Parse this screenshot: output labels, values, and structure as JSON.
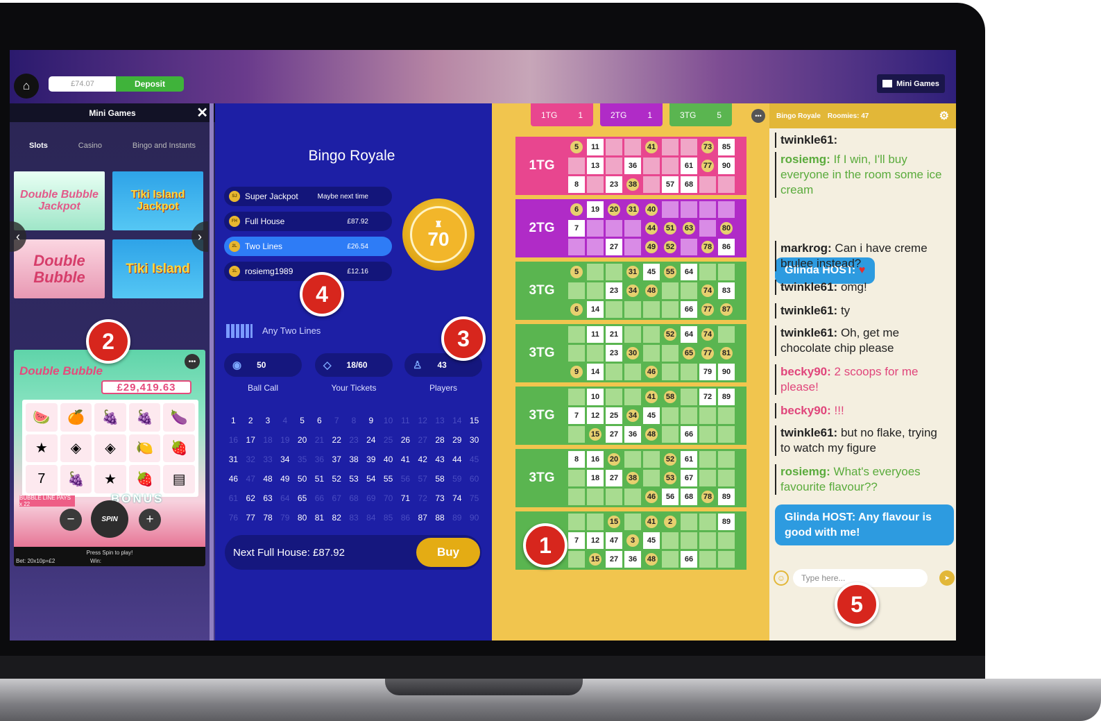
{
  "topbar": {
    "balance": "£74.07",
    "deposit_label": "Deposit",
    "mini_games_label": "Mini Games"
  },
  "mini_games": {
    "title": "Mini Games",
    "tabs": [
      "Slots",
      "Casino",
      "Bingo and Instants"
    ],
    "thumbs": [
      "Double Bubble Jackpot",
      "Tiki Island Jackpot",
      "Double Bubble",
      "Tiki Island"
    ],
    "slot": {
      "title": "Double Bubble",
      "jackpot": "£29,419.63",
      "bubble_line": "BUBBLE LINE PAYS x 22",
      "bonus": "BONUS",
      "spin_label": "SPIN",
      "press": "Press Spin to play!",
      "bet": "Bet: 20x10p=£2",
      "win": "Win:"
    }
  },
  "bingo": {
    "title": "Bingo Royale",
    "prizes": [
      {
        "badge": "SJ",
        "label": "Super Jackpot",
        "amount": "Maybe next time"
      },
      {
        "badge": "FH",
        "label": "Full House",
        "amount": "£87.92"
      },
      {
        "badge": "2L",
        "label": "Two Lines",
        "amount": "£26.54"
      },
      {
        "badge": "1L",
        "label": "rosiemg1989",
        "amount": "£12.16"
      }
    ],
    "ball": "70",
    "pattern": "Any Two Lines",
    "stats": [
      {
        "value": "50",
        "label": "Ball Call"
      },
      {
        "value": "18/60",
        "label": "Your Tickets"
      },
      {
        "value": "43",
        "label": "Players"
      }
    ],
    "called": [
      1,
      2,
      3,
      5,
      6,
      9,
      15,
      17,
      20,
      22,
      24,
      26,
      28,
      29,
      30,
      31,
      34,
      37,
      38,
      39,
      40,
      41,
      42,
      43,
      44,
      46,
      48,
      49,
      50,
      51,
      52,
      53,
      54,
      55,
      58,
      62,
      63,
      65,
      71,
      73,
      74,
      77,
      78,
      80,
      81,
      82,
      87,
      88
    ],
    "next_full_house_label": "Next Full House:",
    "next_full_house": "£87.92",
    "buy_label": "Buy"
  },
  "tickets": {
    "tabs": [
      {
        "label": "1TG",
        "count": "1"
      },
      {
        "label": "2TG",
        "count": "1"
      },
      {
        "label": "3TG",
        "count": "5"
      }
    ],
    "cards": [
      {
        "label": "1TG",
        "rows": [
          [
            "5",
            "11",
            "",
            "",
            "41",
            "",
            "",
            "73",
            "85"
          ],
          [
            "",
            "13",
            "",
            "36",
            "",
            "",
            "61",
            "77",
            "90"
          ],
          [
            "8",
            "",
            "23",
            "38",
            "",
            "57",
            "68",
            "",
            ""
          ]
        ]
      },
      {
        "label": "2TG",
        "rows": [
          [
            "6",
            "19",
            "20",
            "31",
            "40",
            "",
            "",
            "",
            ""
          ],
          [
            "7",
            "",
            "",
            "",
            "44",
            "51",
            "63",
            "",
            "80"
          ],
          [
            "",
            "",
            "27",
            "",
            "49",
            "52",
            "",
            "78",
            "86"
          ]
        ]
      },
      {
        "label": "3TG",
        "rows": [
          [
            "5",
            "",
            "",
            "31",
            "45",
            "55",
            "64",
            "",
            ""
          ],
          [
            "",
            "",
            "23",
            "34",
            "48",
            "",
            "",
            "74",
            "83"
          ],
          [
            "6",
            "14",
            "",
            "",
            "",
            "",
            "66",
            "77",
            "87"
          ]
        ]
      },
      {
        "label": "3TG",
        "rows": [
          [
            "",
            "11",
            "21",
            "",
            "",
            "52",
            "64",
            "74",
            ""
          ],
          [
            "",
            "",
            "23",
            "30",
            "",
            "",
            "65",
            "77",
            "81"
          ],
          [
            "9",
            "14",
            "",
            "",
            "46",
            "",
            "",
            "79",
            "90"
          ]
        ]
      },
      {
        "label": "3TG",
        "rows": [
          [
            "",
            "10",
            "",
            "",
            "41",
            "58",
            "",
            "72",
            "89"
          ],
          [
            "7",
            "12",
            "25",
            "34",
            "45",
            "",
            "",
            "",
            ""
          ],
          [
            "",
            "15",
            "27",
            "36",
            "48",
            "",
            "66",
            "",
            ""
          ]
        ]
      },
      {
        "label": "3TG",
        "rows": [
          [
            "8",
            "16",
            "20",
            "",
            "",
            "52",
            "61",
            "",
            ""
          ],
          [
            "",
            "18",
            "27",
            "38",
            "",
            "53",
            "67",
            "",
            ""
          ],
          [
            "",
            "",
            "",
            "",
            "46",
            "56",
            "68",
            "78",
            "89"
          ]
        ]
      },
      {
        "label": "",
        "rows": [
          [
            "",
            "",
            "15",
            "",
            "41",
            "2",
            "",
            "",
            "89"
          ],
          [
            "7",
            "12",
            "47",
            "3",
            "45",
            "",
            "",
            "",
            ""
          ],
          [
            "",
            "15",
            "27",
            "36",
            "48",
            "",
            "66",
            "",
            ""
          ]
        ]
      }
    ]
  },
  "chat": {
    "room": "Bingo Royale",
    "roomies": "Roomies: 47",
    "messages": [
      {
        "user": "twinkle61:",
        "text": "",
        "color": "#222222"
      },
      {
        "user": "rosiemg:",
        "text": "If I win, I'll buy everyone in the room some ice cream",
        "color": "#5aab3c"
      },
      {
        "user": "markrog:",
        "text": "Can i have creme brulee instead?",
        "color": "#222222"
      },
      {
        "user": "twinkle61:",
        "text": "omg!",
        "color": "#222222"
      },
      {
        "user": "twinkle61:",
        "text": "ty",
        "color": "#222222"
      },
      {
        "user": "twinkle61:",
        "text": "Oh, get me chocolate chip please",
        "color": "#222222"
      },
      {
        "user": "becky90:",
        "text": "2 scoops for me please!",
        "color": "#e0457b"
      },
      {
        "user": "becky90:",
        "text": "!!!",
        "color": "#e0457b"
      },
      {
        "user": "twinkle61:",
        "text": "but no flake, trying to watch my figure",
        "color": "#222222"
      },
      {
        "user": "rosiemg:",
        "text": "What's everyoes favourite flavour??",
        "color": "#5aab3c"
      }
    ],
    "host1": "Glinda HOST:",
    "host2": "Glinda HOST: Any flavour is good with me!",
    "placeholder": "Type here..."
  },
  "markers": [
    "1",
    "2",
    "3",
    "4",
    "5"
  ]
}
